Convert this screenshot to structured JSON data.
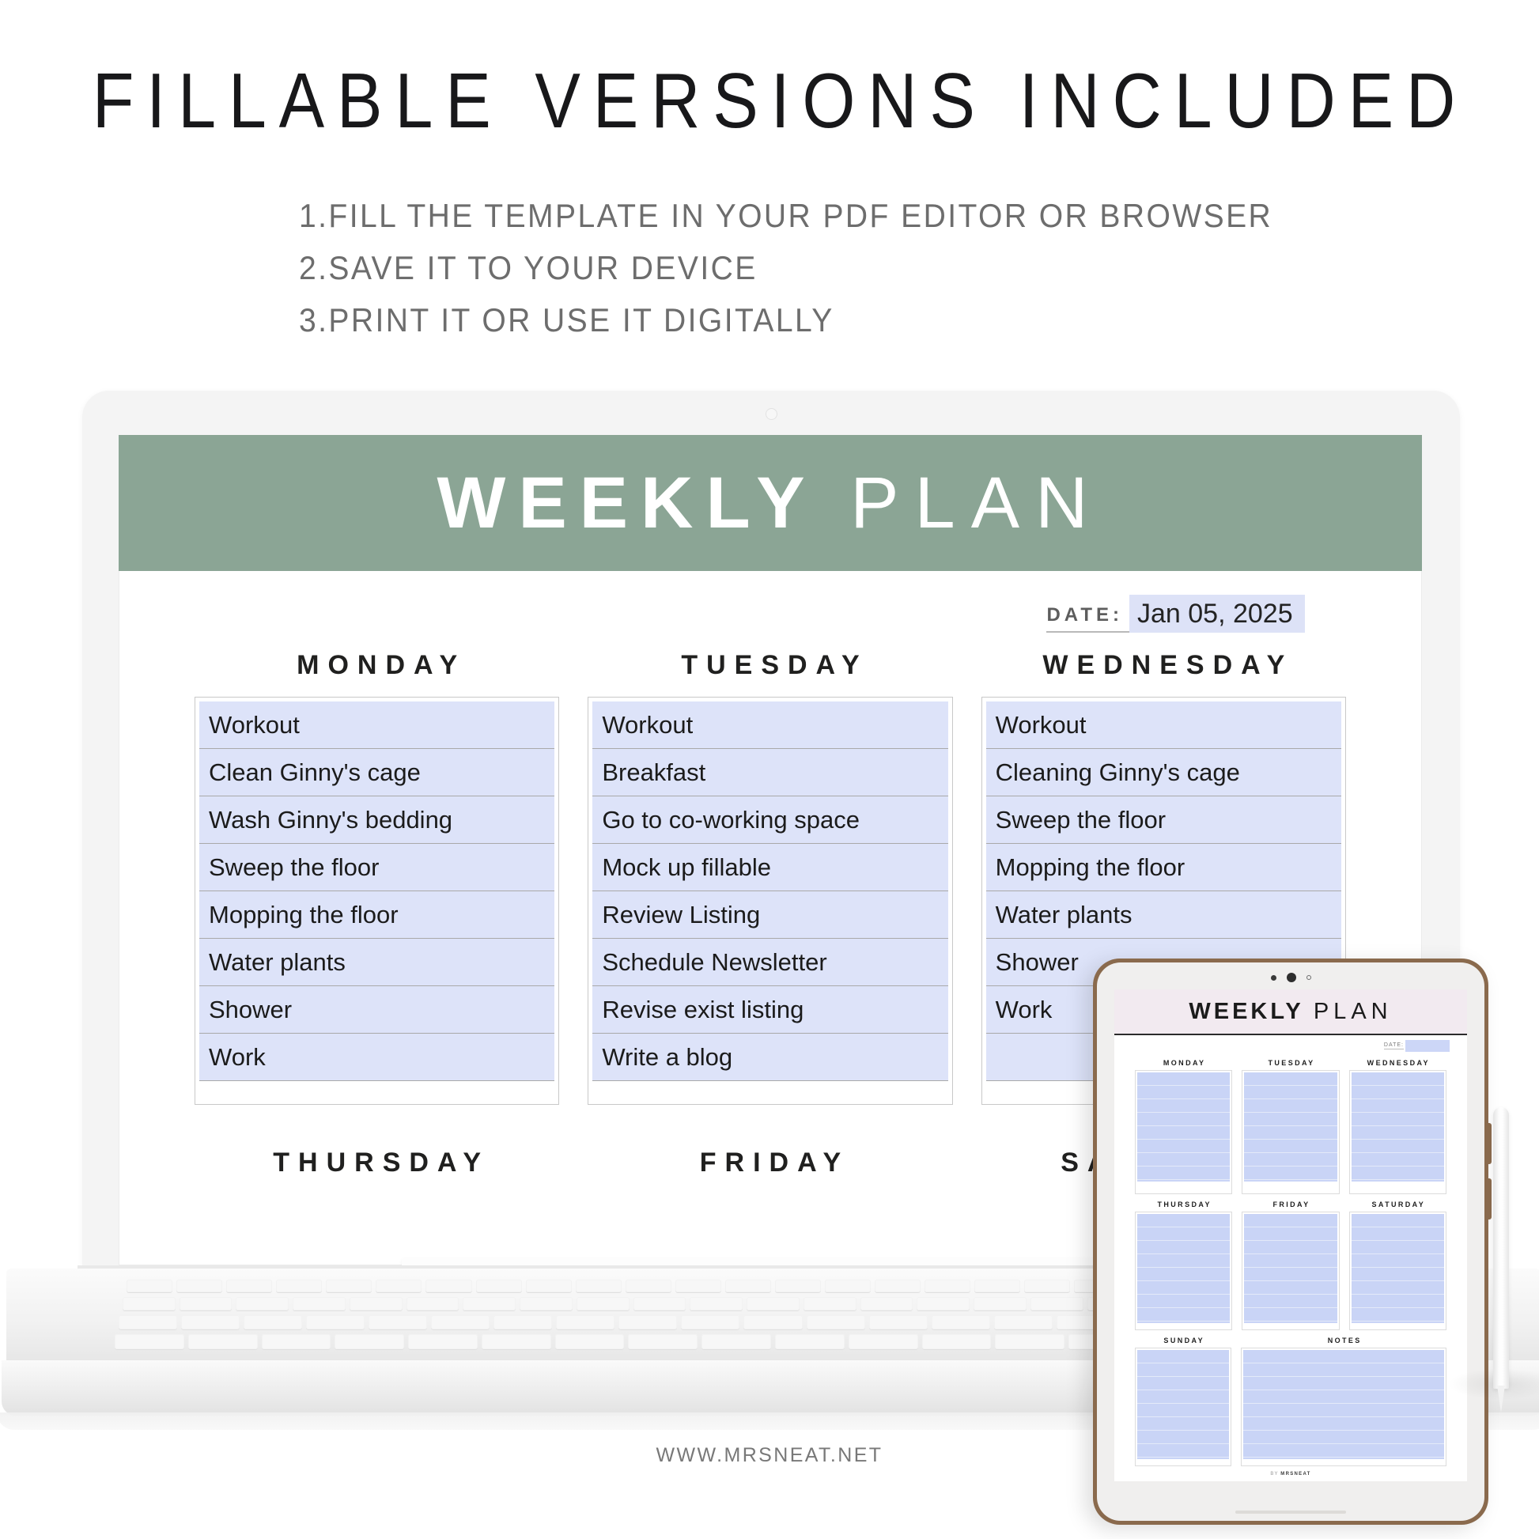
{
  "headline": "FILLABLE VERSIONS INCLUDED",
  "steps": [
    "1.FILL THE TEMPLATE IN YOUR PDF EDITOR OR BROWSER",
    "2.SAVE IT TO YOUR DEVICE",
    "3.PRINT IT OR USE IT DIGITALLY"
  ],
  "colors": {
    "header_green": "#8ba595",
    "field_blue": "#dde3f9",
    "tablet_header_pink": "#f2eaf0",
    "tablet_frame_brown": "#8a6a4d",
    "text_gray": "#6d6d6d"
  },
  "laptop": {
    "planner": {
      "title_bold": "WEEKLY",
      "title_light": "PLAN",
      "date_label": "DATE:",
      "date_value": "Jan 05, 2025",
      "days": [
        {
          "name": "MONDAY",
          "tasks": [
            "Workout",
            "Clean Ginny's cage",
            "Wash Ginny's bedding",
            "Sweep the floor",
            "Mopping the floor",
            "Water plants",
            "Shower",
            "Work"
          ]
        },
        {
          "name": "TUESDAY",
          "tasks": [
            "Workout",
            "Breakfast",
            "Go to co-working space",
            "Mock up fillable",
            "Review Listing",
            "Schedule Newsletter",
            "Revise exist listing",
            "Write a blog"
          ]
        },
        {
          "name": "WEDNESDAY",
          "tasks": [
            "Workout",
            "Cleaning Ginny's cage",
            "Sweep the floor",
            "Mopping the floor",
            "Water plants",
            "Shower",
            "Work",
            ""
          ]
        }
      ],
      "days_bottom": [
        "THURSDAY",
        "FRIDAY",
        "SATURDAY"
      ]
    }
  },
  "tablet": {
    "planner": {
      "title_bold": "WEEKLY",
      "title_light": "PLAN",
      "date_label": "DATE:",
      "date_value": "",
      "row1": [
        "MONDAY",
        "TUESDAY",
        "WEDNESDAY"
      ],
      "row2": [
        "THURSDAY",
        "FRIDAY",
        "SATURDAY"
      ],
      "row3": [
        "SUNDAY",
        "NOTES"
      ],
      "footer_prefix": "BY",
      "footer_brand": "MRSNEAT"
    }
  },
  "site_url": "WWW.MRSNEAT.NET"
}
